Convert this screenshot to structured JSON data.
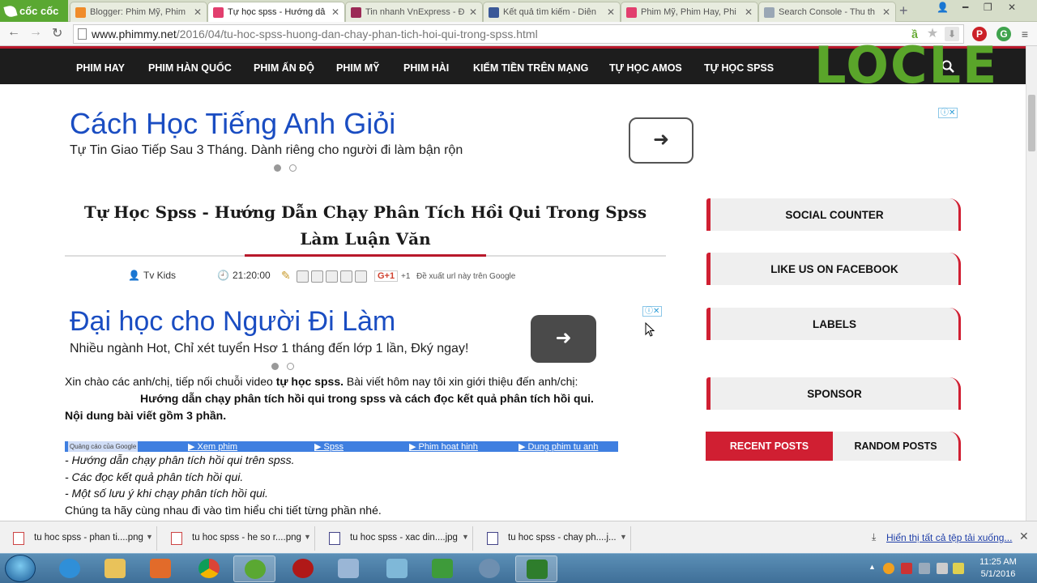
{
  "browser": {
    "brand": "cốc cốc",
    "tabs": [
      {
        "title": "Blogger: Phim Mỹ, Phim",
        "active": false,
        "favicon_color": "#f08c2b"
      },
      {
        "title": "Tự học spss - Hướng dẫ",
        "active": true,
        "favicon_color": "#e23f6e"
      },
      {
        "title": "Tin nhanh VnExpress - Đ",
        "active": false,
        "favicon_color": "#9b2a56"
      },
      {
        "title": "Kết quả tìm kiếm - Diễn",
        "active": false,
        "favicon_color": "#3b5998"
      },
      {
        "title": "Phim Mỹ, Phim Hay, Phi",
        "active": false,
        "favicon_color": "#e23f6e"
      },
      {
        "title": "Search Console - Thu th",
        "active": false,
        "favicon_color": "#9aa7b5"
      }
    ],
    "new_tab": "+",
    "url_domain": "www.phimmy.net",
    "url_path": "/2016/04/tu-hoc-spss-huong-dan-chay-phan-tich-hoi-qui-trong-spss.html"
  },
  "nav": {
    "items": [
      "PHIM HAY",
      "PHIM HÀN QUỐC",
      "PHIM ẤN ĐỘ",
      "PHIM MỸ",
      "PHIM HÀI",
      "KIẾM TIỀN TRÊN MẠNG",
      "TỰ HỌC AMOS",
      "TỰ HỌC SPSS"
    ],
    "watermark": "LOCLE"
  },
  "ad1": {
    "title": "Cách Học Tiếng Anh Giỏi",
    "subtitle": "Tự Tin Giao Tiếp Sau 3 Tháng. Dành riêng cho người đi làm bận rộn",
    "arrow": "➜"
  },
  "article": {
    "title": "Tự Học Spss - Hướng Dẫn Chạy Phân Tích Hồi Qui Trong Spss Làm Luận Văn",
    "author": "Tv Kids",
    "time": "21:20:00",
    "gplus": "G+1",
    "plus_count": "+1",
    "suggest": "Đề xuất url này trên Google"
  },
  "ad2": {
    "title": "Đại học cho Người Đi Làm",
    "subtitle": "Nhiều ngành Hot, Chỉ xét tuyển Hsơ 1 tháng đến lớp 1 lần, Đký ngay!",
    "arrow": "➜"
  },
  "body": {
    "intro_a": "Xin chào các anh/chị, tiếp nối chuỗi video ",
    "intro_b": "tự học spss.",
    "intro_c": " Bài viết hôm nay tôi xin giới thiệu đến anh/chị:",
    "bold_line": "Hướng dẫn chạy phân tích hồi qui trong spss và cách đọc kết quả phân tích hồi qui.",
    "parts": "Nội dung bài viết gồm 3 phần.",
    "list": [
      "- Hướng dẫn chạy phân tích hồi qui trên spss.",
      "- Các đọc kết quả phân tích hồi qui.",
      "- Một số lưu ý khi chạy phân tích hồi qui."
    ],
    "closing": "Chúng ta hãy cùng nhau đi vào tìm hiểu chi tiết từng phần nhé."
  },
  "adlinks": {
    "label": "Quảng cáo của Google",
    "links": [
      "▶ Xem phim",
      "▶ Spss",
      "▶ Phim hoat hinh",
      "▶ Dung phim tu anh"
    ]
  },
  "sidebar": {
    "widgets": [
      "SOCIAL COUNTER",
      "LIKE US ON FACEBOOK",
      "LABELS",
      "SPONSOR"
    ],
    "tabs": [
      "RECENT POSTS",
      "RANDOM POSTS"
    ]
  },
  "downloads": {
    "files": [
      "tu hoc spss - phan ti....png",
      "tu hoc spss - he so r....png",
      "tu hoc spss - xac din....jpg",
      "tu hoc spss - chay ph....j..."
    ],
    "show_all": "Hiển thị tất cả tệp tải xuống..."
  },
  "taskbar": {
    "time": "11:25 AM",
    "date": "5/1/2016"
  }
}
